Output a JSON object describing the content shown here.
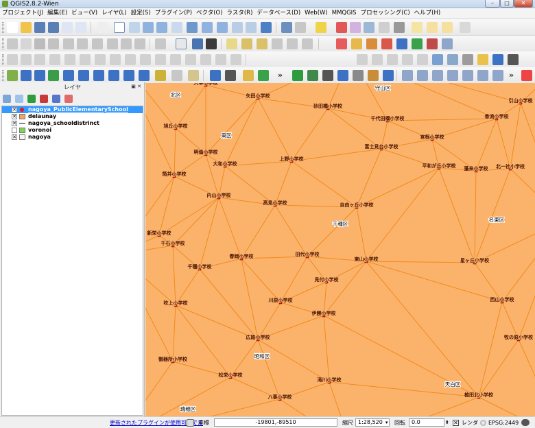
{
  "window": {
    "title": "QGIS2.8.2-Wien",
    "btn_min": "–",
    "btn_max": "□",
    "btn_close": "✕"
  },
  "menu": [
    "プロジェクト(J)",
    "編集(E)",
    "ビュー(V)",
    "レイヤ(L)",
    "設定(S)",
    "プラグイン(P)",
    "ベクタ(O)",
    "ラスタ(R)",
    "データベース(D)",
    "Web(W)",
    "MMQGIS",
    "プロセッシング(C)",
    "ヘルプ(H)"
  ],
  "layers_panel": {
    "title": "レイヤ",
    "layers": [
      {
        "name": "nagoya_PublicElementarySchool",
        "checked": true,
        "selected": true,
        "symbol": "point",
        "color": "#e31a1c"
      },
      {
        "name": "delaunay",
        "checked": true,
        "selected": false,
        "symbol": "polygon",
        "color": "#f4a259"
      },
      {
        "name": "nagoya_schooldistrinct",
        "checked": true,
        "selected": false,
        "symbol": "line",
        "color": "#888888"
      },
      {
        "name": "voronoi",
        "checked": false,
        "selected": false,
        "symbol": "polygon",
        "color": "#7bd64f"
      },
      {
        "name": "nagoya",
        "checked": true,
        "selected": false,
        "symbol": "polygon",
        "color": "#f5f5f5"
      }
    ]
  },
  "map": {
    "fill_color": "#fbb36b",
    "edge_color": "#f08a1c",
    "point_color": "#e31a1c",
    "schools": [
      "矢田小学校",
      "砂田橋小学校",
      "千代田橋小学校",
      "旭丘小学校",
      "香流小学校",
      "引山小学校",
      "宮根小学校",
      "富士見台小学校",
      "明倫小学校",
      "大和小学校",
      "上野小学校",
      "平和が丘小学校",
      "蓬来小学校",
      "北一社小学校",
      "筒井小学校",
      "内山小学校",
      "高見小学校",
      "自由ヶ丘小学校",
      "新栄小学校",
      "千石小学校",
      "春岡小学校",
      "田代小学校",
      "東山小学校",
      "星ヶ丘小学校",
      "千種小学校",
      "見付小学校",
      "吹上小学校",
      "川原小学校",
      "西山小学校",
      "伊勝小学校",
      "広路小学校",
      "牧の原小学校",
      "御器所小学校",
      "松栄小学校",
      "滝川小学校",
      "八事小学校",
      "植田北小学校",
      "大幸小学校"
    ],
    "wards": [
      "北区",
      "守山区",
      "東区",
      "千種区",
      "名東区",
      "昭和区",
      "天白区",
      "瑞穂区"
    ]
  },
  "status": {
    "plugin_link": "更新されたプラグインが使用可能です",
    "coord_label": "座標",
    "coord_value": "-19801,-89510",
    "scale_label": "縮尺",
    "scale_value": "1:28,520",
    "rotation_label": "回転",
    "rotation_value": "0.0",
    "render_label": "レンダ",
    "crs": "EPSG:2449"
  }
}
